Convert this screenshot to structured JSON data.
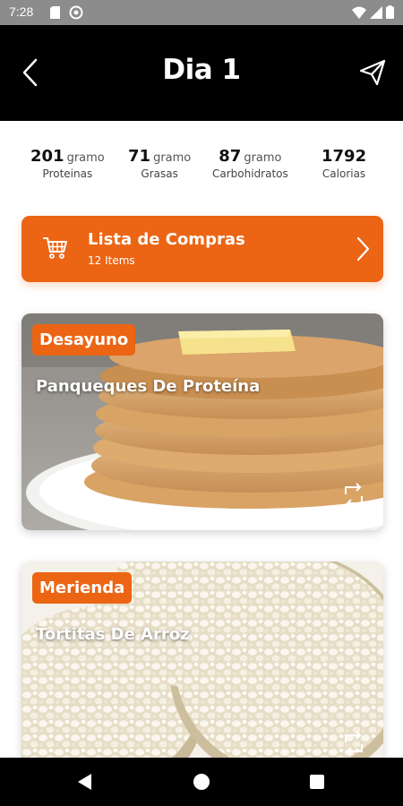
{
  "status_bar": {
    "time": "7:28"
  },
  "header": {
    "title": "Dia 1"
  },
  "macros": [
    {
      "value": "201",
      "unit": "gramo",
      "label": "Proteinas"
    },
    {
      "value": "71",
      "unit": "gramo",
      "label": "Grasas"
    },
    {
      "value": "87",
      "unit": "gramo",
      "label": "Carbohidratos"
    },
    {
      "value": "1792",
      "unit": "",
      "label": "Calorias"
    }
  ],
  "shopping_list": {
    "title": "Lista de Compras",
    "count": "12 Items"
  },
  "meals": [
    {
      "type": "Desayuno",
      "name": "Panqueques De Proteína"
    },
    {
      "type": "Merienda",
      "name": "Tortitas De Arroz"
    }
  ],
  "colors": {
    "accent": "#eb6514",
    "header_bg": "#000000",
    "status_bar_bg": "#8c8c8c"
  },
  "icons": {
    "back": "chevron-left-icon",
    "send": "paper-plane-icon",
    "cart": "shopping-cart-icon",
    "chevron": "chevron-right-icon",
    "swap": "swap-icon"
  }
}
